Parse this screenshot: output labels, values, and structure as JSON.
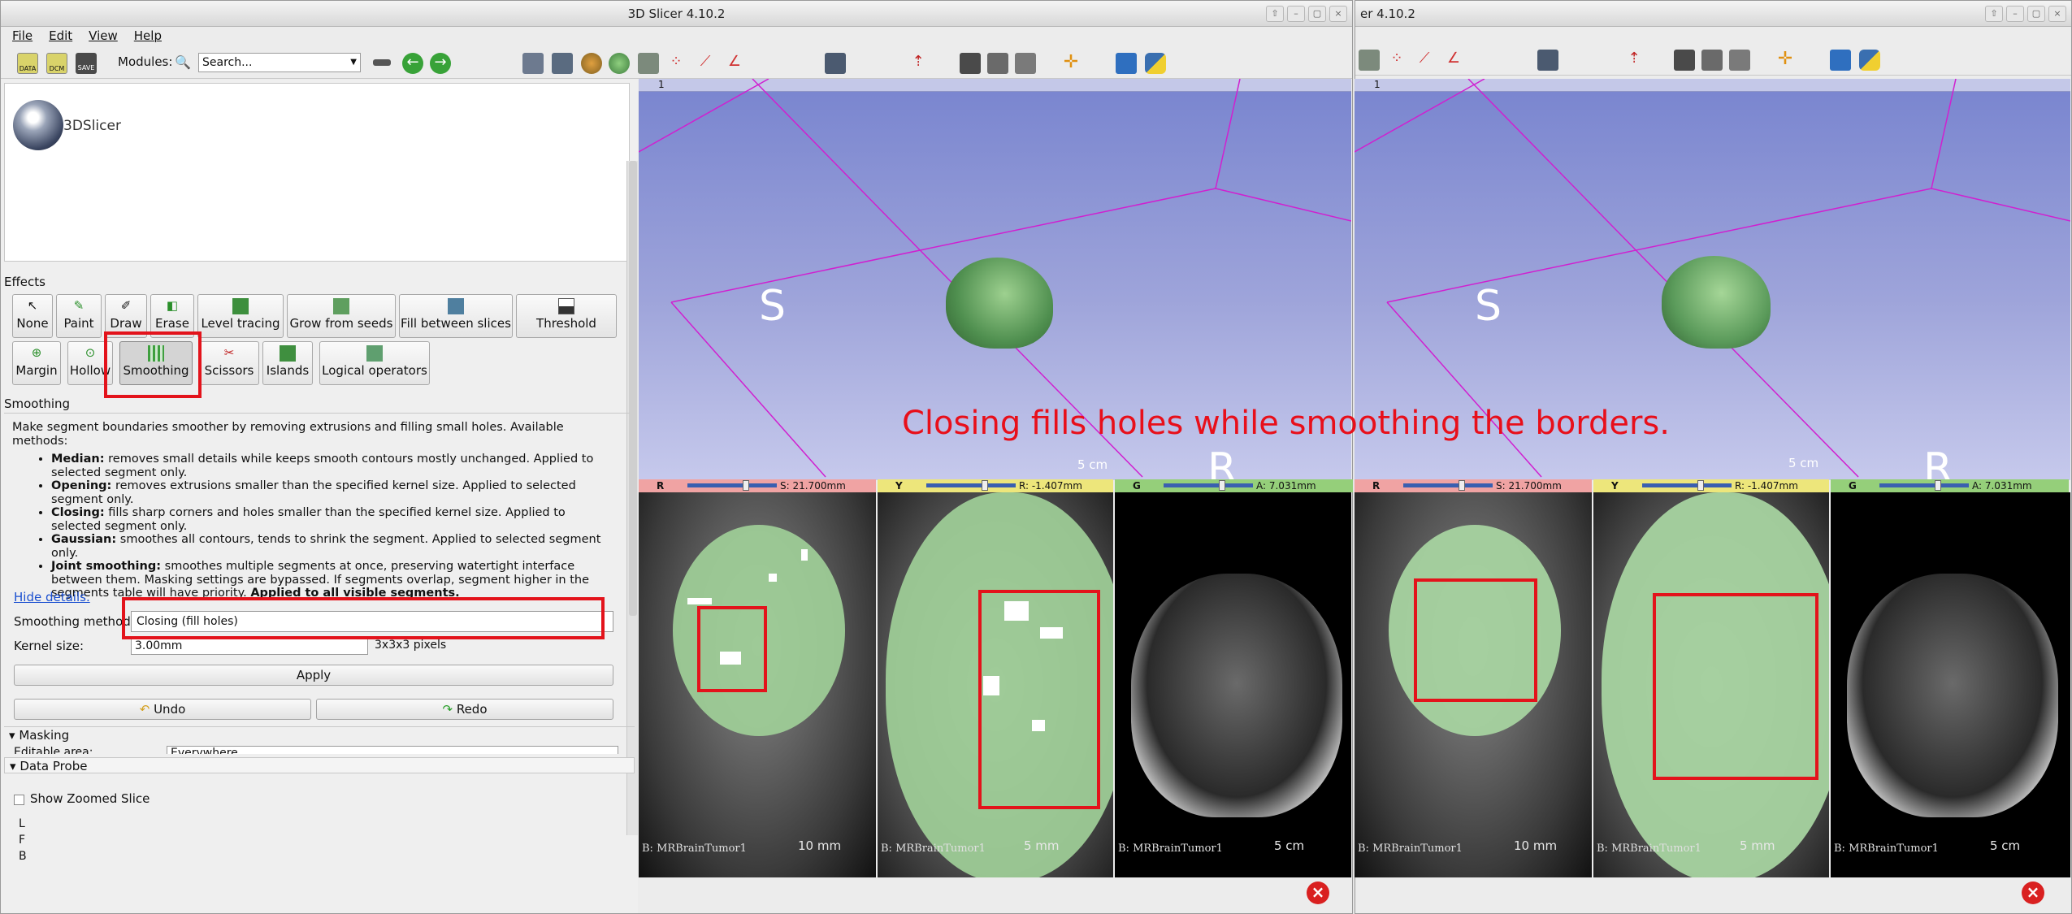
{
  "window_left": {
    "title": "3D Slicer 4.10.2",
    "menu": [
      "File",
      "Edit",
      "View",
      "Help"
    ],
    "toolbar": {
      "data_label": "DATA",
      "dcm_label": "DCM",
      "save_label": "SAVE",
      "modules_label": "Modules:",
      "search_value": "Search..."
    },
    "logo_text": "3DSlicer",
    "effects_title": "Effects",
    "effects_row1": [
      "None",
      "Paint",
      "Draw",
      "Erase",
      "Level tracing",
      "Grow from seeds",
      "Fill between slices",
      "Threshold"
    ],
    "effects_row2": [
      "Margin",
      "Hollow",
      "Smoothing",
      "Scissors",
      "Islands",
      "Logical operators"
    ],
    "active_effect": "Smoothing",
    "smoothing_title": "Smoothing",
    "help_intro": "Make segment boundaries smoother by removing extrusions and filling small holes. Available methods:",
    "help_items": [
      {
        "term": "Median:",
        "text": " removes small details while keeps smooth contours mostly unchanged. Applied to selected segment only."
      },
      {
        "term": "Opening:",
        "text": " removes extrusions smaller than the specified kernel size. Applied to selected segment only."
      },
      {
        "term": "Closing:",
        "text": " fills sharp corners and holes smaller than the specified kernel size. Applied to selected segment only."
      },
      {
        "term": "Gaussian:",
        "text": " smoothes all contours, tends to shrink the segment. Applied to selected segment only."
      },
      {
        "term": "Joint smoothing:",
        "text": " smoothes multiple segments at once, preserving watertight interface between them. Masking settings are bypassed. If segments overlap, segment higher in the segments table will have priority. ",
        "tail": "Applied to all visible segments."
      }
    ],
    "hide_details": "Hide details.",
    "smoothing_method_label": "Smoothing method:",
    "smoothing_method_value": "Closing (fill holes)",
    "kernel_size_label": "Kernel size:",
    "kernel_size_value": "3.00mm",
    "kernel_pixels": "3x3x3 pixels",
    "apply_label": "Apply",
    "undo_label": "Undo",
    "redo_label": "Redo",
    "masking_label": "Masking",
    "editable_area_label": "Editable area:",
    "editable_area_value": "Everywhere",
    "data_probe_label": "Data Probe",
    "show_zoomed_label": "Show Zoomed Slice",
    "probe_letters": [
      "L",
      "F",
      "B"
    ]
  },
  "window_right": {
    "title": "er 4.10.2"
  },
  "views": {
    "view3d_number": "1",
    "orientation_s": "S",
    "orientation_r": "R",
    "scale_3d": "5 cm",
    "slices": [
      {
        "letter": "R",
        "value": "S: 21.700mm",
        "color": "#f0a3a3",
        "volume": "B: MRBrainTumor1",
        "scale": "10 mm"
      },
      {
        "letter": "Y",
        "value": "R: -1.407mm",
        "color": "#ede67b",
        "volume": "B: MRBrainTumor1",
        "scale": "5 mm"
      },
      {
        "letter": "G",
        "value": "A: 7.031mm",
        "color": "#95cf7a",
        "volume": "B: MRBrainTumor1",
        "scale": "5 cm"
      }
    ]
  },
  "annotation": "Closing fills holes while smoothing the borders."
}
